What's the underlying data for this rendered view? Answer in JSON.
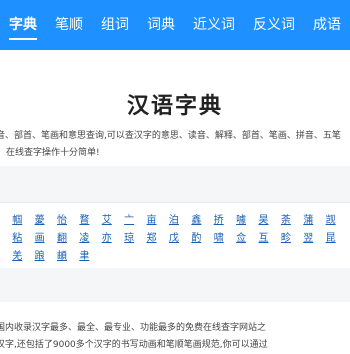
{
  "nav": {
    "items": [
      {
        "label": "字典",
        "active": true
      },
      {
        "label": "笔顺"
      },
      {
        "label": "组词"
      },
      {
        "label": "词典"
      },
      {
        "label": "近义词"
      },
      {
        "label": "反义词"
      },
      {
        "label": "成语"
      }
    ],
    "accent_color": "#1e90ff"
  },
  "title": "汉语字典",
  "intro": {
    "line1": "音、部首、笔画和意思查询,可以查汉字的意思、读音、解释、部首、笔画、拼音、五笔",
    "line2": "在线查字操作十分简单!"
  },
  "characters": [
    "帼",
    "薆",
    "怡",
    "瞀",
    "艾",
    "亠",
    "亩",
    "泊",
    "鑫",
    "挢",
    "噱",
    "昊",
    "荼",
    "蒲",
    "觊",
    "粘",
    "画",
    "翻",
    "凌",
    "亦",
    "琼",
    "郑",
    "戊",
    "酌",
    "啸",
    "佥",
    "互",
    "畛",
    "翌",
    "昆",
    "羌",
    "踉",
    "頔",
    "聿"
  ],
  "footer": {
    "line1": "国内收录汉字最多、最全、最专业、功能最多的免费在线查字网站之",
    "line2": "汉字,还包括了9000多个汉字的书写动画和笔顺笔画规范,你可以通过"
  }
}
